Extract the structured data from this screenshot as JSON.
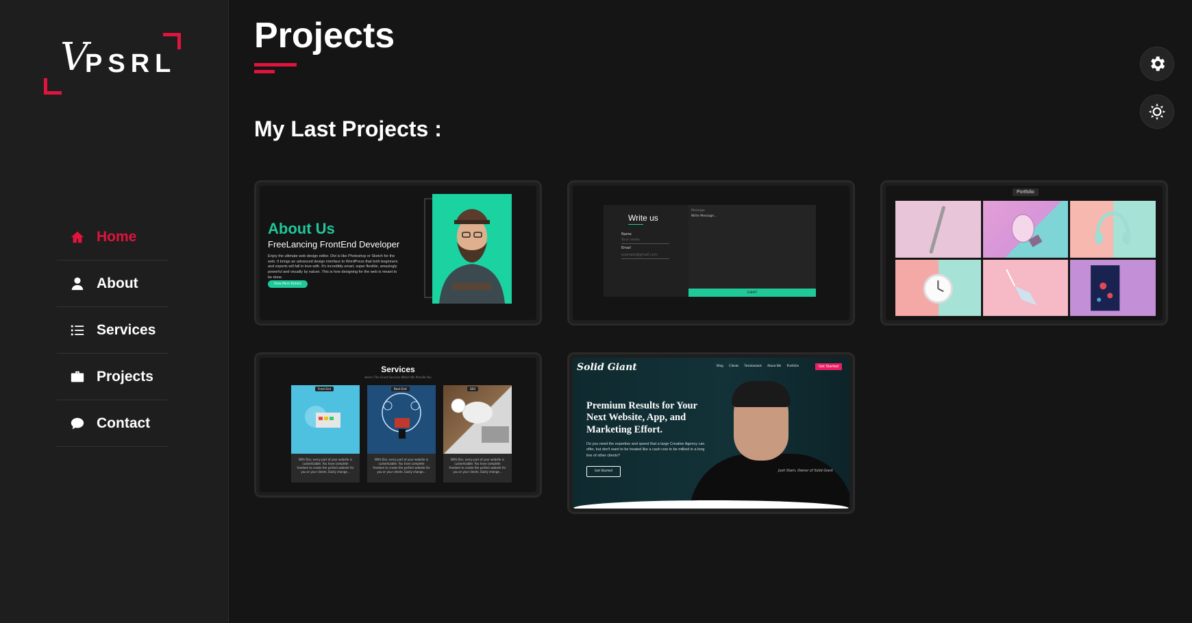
{
  "brand": {
    "logo_text": "PSRL",
    "logo_mark": "V"
  },
  "nav": {
    "items": [
      {
        "label": "Home",
        "icon": "home-icon",
        "active": true
      },
      {
        "label": "About",
        "icon": "user-icon",
        "active": false
      },
      {
        "label": "Services",
        "icon": "list-icon",
        "active": false
      },
      {
        "label": "Projects",
        "icon": "briefcase-icon",
        "active": false
      },
      {
        "label": "Contact",
        "icon": "chat-icon",
        "active": false
      }
    ]
  },
  "main": {
    "title": "Projects",
    "subtitle": "My Last Projects :"
  },
  "tools": {
    "settings_icon": "gear-icon",
    "theme_icon": "sun-icon"
  },
  "projects": {
    "p1": {
      "title": "About Us",
      "subtitle": "FreeLancing FrontEnd Developer",
      "body": "Enjoy the ultimate web design editor. Divi is like Photoshop or Sketch for the web. It brings an advanced design interface to WordPress that both beginners and experts will fall in love with. It's incredibly smart, super flexible, amazingly powerful and visually by nature. This is how designing for the web is meant to be done.",
      "button": "View More Details"
    },
    "p2": {
      "title": "Write us",
      "name_label": "Name",
      "name_placeholder": "Your name",
      "email_label": "Email",
      "email_placeholder": "example@gmail.com",
      "message_label": "Message",
      "message_placeholder": "Write Message...",
      "submit": "SUBMIT"
    },
    "p3": {
      "label": "Portfolio"
    },
    "p4": {
      "title": "Services",
      "subtitle": "Here's The Great Services Which We Provide You",
      "items": [
        {
          "tag": "Front End",
          "text": "With Divi, every part of your website is customizable. You have complete freedom to create the perfect website for you or your clients. Easily change..."
        },
        {
          "tag": "Back End",
          "text": "With Divi, every part of your website is customizable. You have complete freedom to create the perfect website for you or your clients. Easily change..."
        },
        {
          "tag": "SEO",
          "text": "With Divi, every part of your website is customizable. You have complete freedom to create the perfect website for you or your clients. Easily change..."
        }
      ]
    },
    "p5": {
      "brand": "Solid Giant",
      "menu": [
        "Blog",
        "Clients",
        "Testimonials",
        "About Me",
        "Portfolio"
      ],
      "cta": "Get Started",
      "headline": "Premium Results for Your Next Website, App, and Marketing Effort.",
      "body": "Do you need the expertise and speed that a large Creative Agency can offer, but don't want to be treated like a cash cow to be milked in a long line of other clients?",
      "button": "Get Started",
      "caption": "Josh Stam, Owner of Solid Giant"
    }
  },
  "colors": {
    "accent": "#e0143c",
    "teal": "#1fc99a",
    "pink": "#e91e63",
    "bg": "#151515",
    "sidebar": "#1e1e1e"
  }
}
